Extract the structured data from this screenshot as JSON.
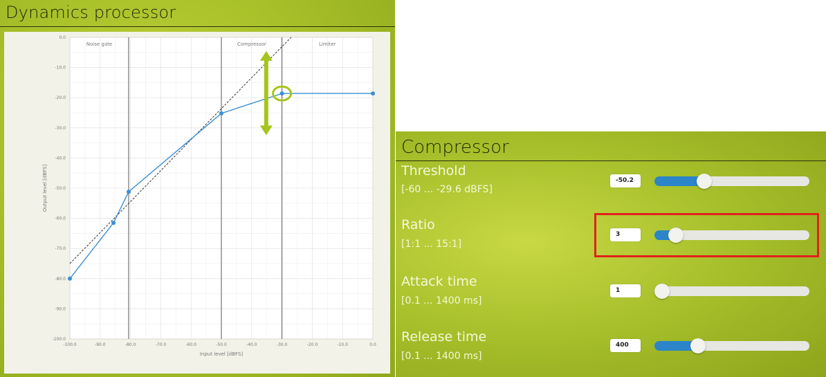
{
  "dynamics": {
    "title": "Dynamics processor",
    "chart_data": {
      "type": "line",
      "xlabel": "Input level [dBFS]",
      "ylabel": "Output level [dBFS]",
      "xlim": [
        -100,
        0
      ],
      "ylim": [
        -100,
        0
      ],
      "x_ticks": [
        "-100.0",
        "-90.0",
        "-80.0",
        "-70.0",
        "-60.0",
        "-50.0",
        "-40.0",
        "-30.0",
        "-20.0",
        "-10.0",
        "0.0"
      ],
      "y_ticks": [
        "0.0",
        "-10.0",
        "-20.0",
        "-30.0",
        "-40.0",
        "-50.0",
        "-60.0",
        "-70.0",
        "-80.0",
        "-90.0",
        "-100.0"
      ],
      "grid": true,
      "regions": [
        {
          "label": "Noise gate",
          "x_start": -100,
          "x_end": -80.6
        },
        {
          "label": "Compressor",
          "x_start": -50.0,
          "x_end": -30.0
        },
        {
          "label": "Limiter",
          "x_start": -30.0,
          "x_end": 0
        }
      ],
      "region_boundaries": [
        -80.6,
        -50.0,
        -30.0
      ],
      "series": [
        {
          "points": [
            [
              -100,
              -80
            ],
            [
              -85.6,
              -61.5
            ],
            [
              -80.6,
              -51.2
            ],
            [
              -50.0,
              -25.2
            ],
            [
              -30.0,
              -18.6
            ],
            [
              0,
              -18.6
            ]
          ],
          "color": "#3a8ed6"
        }
      ],
      "reference_line": {
        "points": [
          [
            -100,
            -75
          ],
          [
            -27,
            0
          ]
        ],
        "style": "dashed",
        "color": "#333333"
      },
      "annotations": {
        "double_arrow": {
          "x": -35.2,
          "y_top": -5,
          "y_bottom": -32,
          "color": "#a6c51b"
        },
        "circle_point": {
          "x": -30.0,
          "y": -18.6,
          "color": "#a6c51b"
        }
      }
    }
  },
  "compressor": {
    "title": "Compressor",
    "params": [
      {
        "name": "Threshold",
        "range": "[-60 ... -29.6 dBFS]",
        "value": "-50.2",
        "fill_fraction": 0.32
      },
      {
        "name": "Ratio",
        "range": "[1:1 ... 15:1]",
        "value": "3",
        "fill_fraction": 0.14
      },
      {
        "name": "Attack time",
        "range": "[0.1 ... 1400 ms]",
        "value": "1",
        "fill_fraction": 0.0
      },
      {
        "name": "Release time",
        "range": "[0.1 ... 1400 ms]",
        "value": "400",
        "fill_fraction": 0.28
      }
    ],
    "slider_fill_color": "#2b85c8",
    "highlight_color": "#e3201b"
  }
}
